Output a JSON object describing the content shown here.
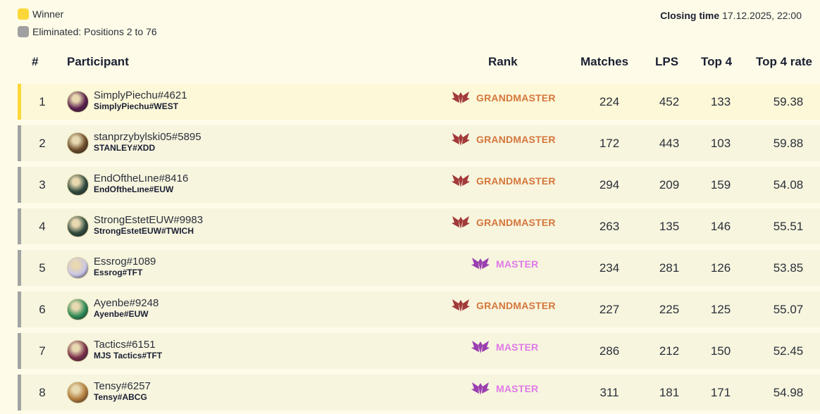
{
  "legend": {
    "winner": "Winner",
    "eliminated": "Eliminated: Positions 2 to 76"
  },
  "closing": {
    "label": "Closing time",
    "value": "17.12.2025, 22:00"
  },
  "columns": {
    "pos": "#",
    "participant": "Participant",
    "rank": "Rank",
    "matches": "Matches",
    "lps": "LPS",
    "top4": "Top 4",
    "top4_rate": "Top 4 rate"
  },
  "colors": {
    "winner": "#fcd73a",
    "eliminated": "#a0a0a0",
    "grandmaster": "#d5763c",
    "master": "#e07ae8"
  },
  "rows": [
    {
      "pos": "1",
      "riot": "SimplyPiechu#4621",
      "tag": "SimplyPiechu#WEST",
      "rank": "GRANDMASTER",
      "tier": "gm",
      "matches": "224",
      "lps": "452",
      "top4": "133",
      "rate": "59.38",
      "status": "winner",
      "avatar_color": "#5a1f4d"
    },
    {
      "pos": "2",
      "riot": "stanprzybylski05#5895",
      "tag": "STANLEY#XDD",
      "rank": "GRANDMASTER",
      "tier": "gm",
      "matches": "172",
      "lps": "443",
      "top4": "103",
      "rate": "59.88",
      "status": "eliminated",
      "avatar_color": "#6b4a2a"
    },
    {
      "pos": "3",
      "riot": "EndOftheLıne#8416",
      "tag": "EndOftheLıne#EUW",
      "rank": "GRANDMASTER",
      "tier": "gm",
      "matches": "294",
      "lps": "209",
      "top4": "159",
      "rate": "54.08",
      "status": "eliminated",
      "avatar_color": "#2f4a3e"
    },
    {
      "pos": "4",
      "riot": "StrongEstetEUW#9983",
      "tag": "StrongEstetEUW#TWICH",
      "rank": "GRANDMASTER",
      "tier": "gm",
      "matches": "263",
      "lps": "135",
      "top4": "146",
      "rate": "55.51",
      "status": "eliminated",
      "avatar_color": "#2f4a3e"
    },
    {
      "pos": "5",
      "riot": "Essrog#1089",
      "tag": "Essrog#TFT",
      "rank": "MASTER",
      "tier": "master",
      "matches": "234",
      "lps": "281",
      "top4": "126",
      "rate": "53.85",
      "status": "eliminated",
      "avatar_color": "#c9c6e6"
    },
    {
      "pos": "6",
      "riot": "Ayenbe#9248",
      "tag": "Ayenbe#EUW",
      "rank": "GRANDMASTER",
      "tier": "gm",
      "matches": "227",
      "lps": "225",
      "top4": "125",
      "rate": "55.07",
      "status": "eliminated",
      "avatar_color": "#2d8a55"
    },
    {
      "pos": "7",
      "riot": "Tactics#6151",
      "tag": "MJS Tactics#TFT",
      "rank": "MASTER",
      "tier": "master",
      "matches": "286",
      "lps": "212",
      "top4": "150",
      "rate": "52.45",
      "status": "eliminated",
      "avatar_color": "#7a2f4a"
    },
    {
      "pos": "8",
      "riot": "Tensy#6257",
      "tag": "Tensy#ABCG",
      "rank": "MASTER",
      "tier": "master",
      "matches": "311",
      "lps": "181",
      "top4": "171",
      "rate": "54.98",
      "status": "eliminated",
      "avatar_color": "#b07a3a"
    }
  ]
}
